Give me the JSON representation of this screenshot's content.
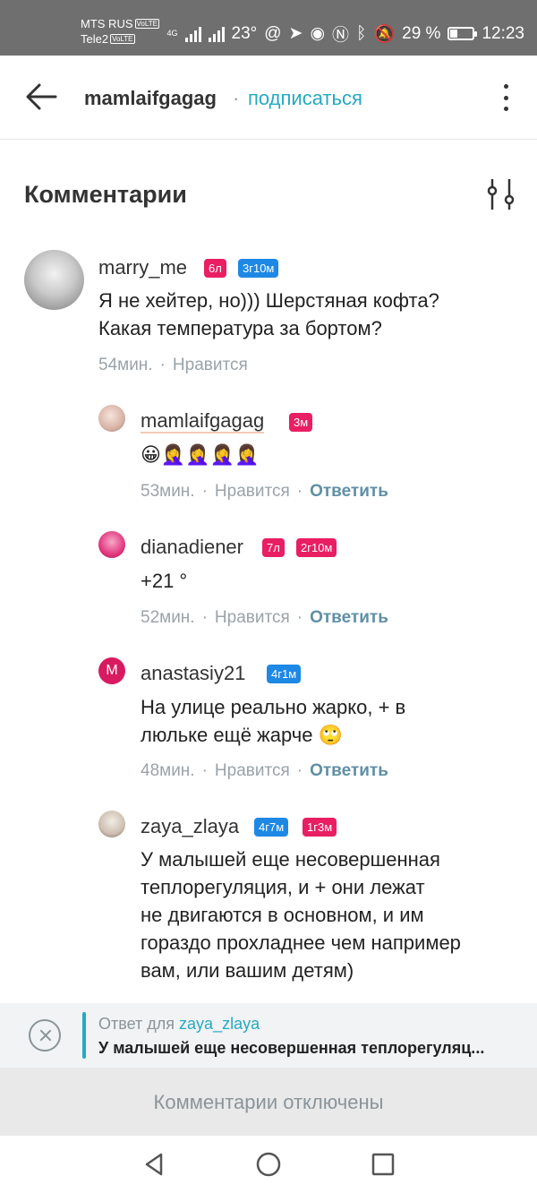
{
  "status_bar": {
    "carrier1": "MTS RUS",
    "carrier2": "Tele2",
    "volte": "VoLTE",
    "net": "4G",
    "temp": "23°",
    "battery": "29 %",
    "time": "12:23"
  },
  "header": {
    "username": "mamlaifgagag",
    "dot": "·",
    "subscribe": "подписаться"
  },
  "comments_title": "Комментарии",
  "comments": [
    {
      "user": "marry_me",
      "badges": [
        "6л",
        "3г10м"
      ],
      "text": "Я не хейтер, но))) Шерстяная кофта?\nКакая температура за бортом?",
      "time": "54мин.",
      "like": "Нравится"
    },
    {
      "user": "mamlaifgagag",
      "badges": [
        "3м"
      ],
      "text": "😀🤦‍♀️🤦‍♀️🤦‍♀️🤦‍♀️",
      "time": "53мин.",
      "like": "Нравится",
      "reply": "Ответить"
    },
    {
      "user": "dianadiener",
      "badges": [
        "7л",
        "2г10м"
      ],
      "text": "+21 °",
      "time": "52мин.",
      "like": "Нравится",
      "reply": "Ответить"
    },
    {
      "user": "anastasiy21",
      "avatar_letter": "M",
      "badges": [
        "4г1м"
      ],
      "text": "На улице реально жарко, + в\nлюльке ещё жарче 🙄",
      "time": "48мин.",
      "like": "Нравится",
      "reply": "Ответить"
    },
    {
      "user": "zaya_zlaya",
      "badges": [
        "4г7м",
        "1г3м"
      ],
      "text": "У малышей еще несовершенная\nтеплорегуляция, и + они лежат\nне двигаются в основном, и им\nгораздо прохладнее чем например\nвам, или вашим детям)"
    }
  ],
  "reply_bar": {
    "label": "Ответ для",
    "name": "zaya_zlaya",
    "text": "У малышей еще несовершенная теплорегуляц..."
  },
  "disabled": "Комментарии отключены",
  "colors": {
    "accent": "#26a9c4",
    "badge_pink": "#e91e63",
    "badge_blue": "#1e88e5"
  }
}
